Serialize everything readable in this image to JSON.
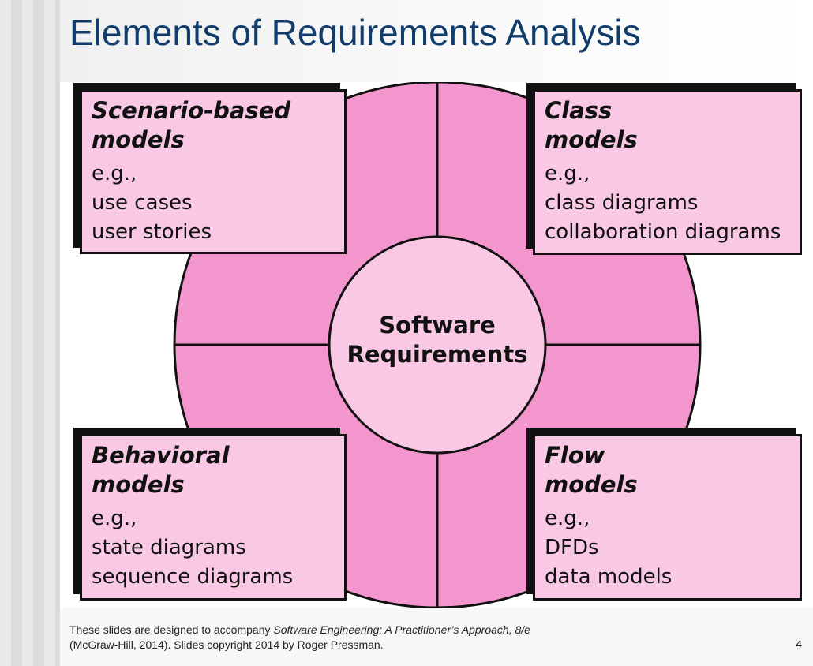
{
  "slide": {
    "title": "Elements of Requirements Analysis",
    "page_number": "4"
  },
  "diagram": {
    "center_line1": "Software",
    "center_line2": "Requirements",
    "boxes": {
      "scenario": {
        "head1": "Scenario-based",
        "head2": "models",
        "line1": "e.g.,",
        "line2": "use cases",
        "line3": "user stories"
      },
      "class": {
        "head1": "Class",
        "head2": "models",
        "line1": "e.g.,",
        "line2": "class diagrams",
        "line3": "collaboration diagrams"
      },
      "behavioral": {
        "head1": "Behavioral",
        "head2": "models",
        "line1": "e.g.,",
        "line2": "state diagrams",
        "line3": "sequence diagrams"
      },
      "flow": {
        "head1": "Flow",
        "head2": "models",
        "line1": "e.g.,",
        "line2": "DFDs",
        "line3": "data models"
      }
    },
    "colors": {
      "ring": "#f396cd",
      "box": "#f9c8e4",
      "center": "#f9c8e4",
      "outline": "#111111",
      "title": "#123c6b"
    }
  },
  "footer": {
    "text1": "These slides are designed to accompany ",
    "book_title": "Software Engineering: A Practitioner’s Approach, 8/e",
    "text2": "(McGraw-Hill, 2014). Slides copyright 2014 by Roger Pressman."
  }
}
